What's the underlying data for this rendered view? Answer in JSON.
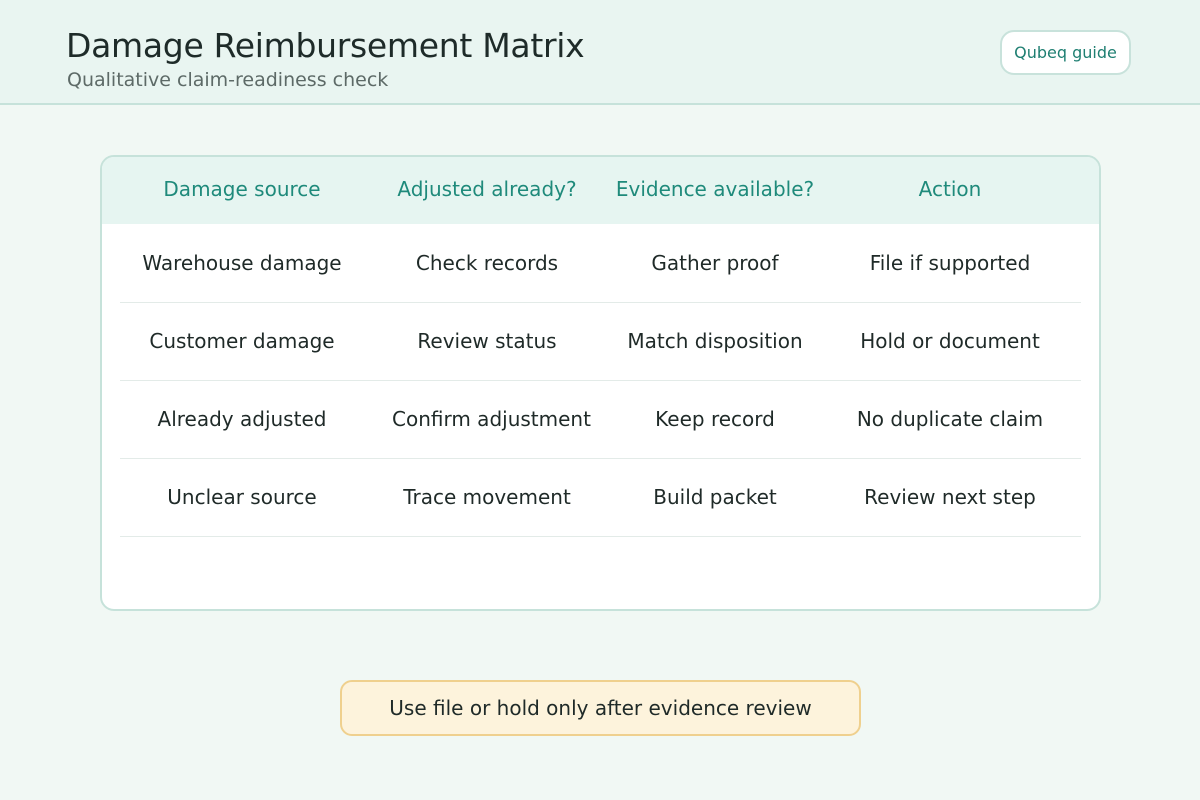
{
  "header": {
    "title": "Damage Reimbursement Matrix",
    "subtitle": "Qualitative claim-readiness check",
    "guide_button_label": "Qubeq guide"
  },
  "matrix": {
    "columns": [
      "Damage source",
      "Adjusted already?",
      "Evidence available?",
      "Action"
    ],
    "rows": [
      [
        "Warehouse damage",
        "Check records",
        "Gather proof",
        "File if supported"
      ],
      [
        "Customer damage",
        "Review status",
        "Match disposition",
        "Hold or document"
      ],
      [
        "Already adjusted",
        "Confirm adjustment",
        "Keep record",
        "No duplicate claim"
      ],
      [
        "Unclear source",
        "Trace movement",
        "Build packet",
        "Review next step"
      ]
    ]
  },
  "note": {
    "text": "Use file or hold only after evidence review"
  },
  "colors": {
    "accent": "#1f8a7b",
    "header_bg": "#e9f5f1",
    "note_bg": "#fdf3dc",
    "note_border": "#efd08e"
  }
}
